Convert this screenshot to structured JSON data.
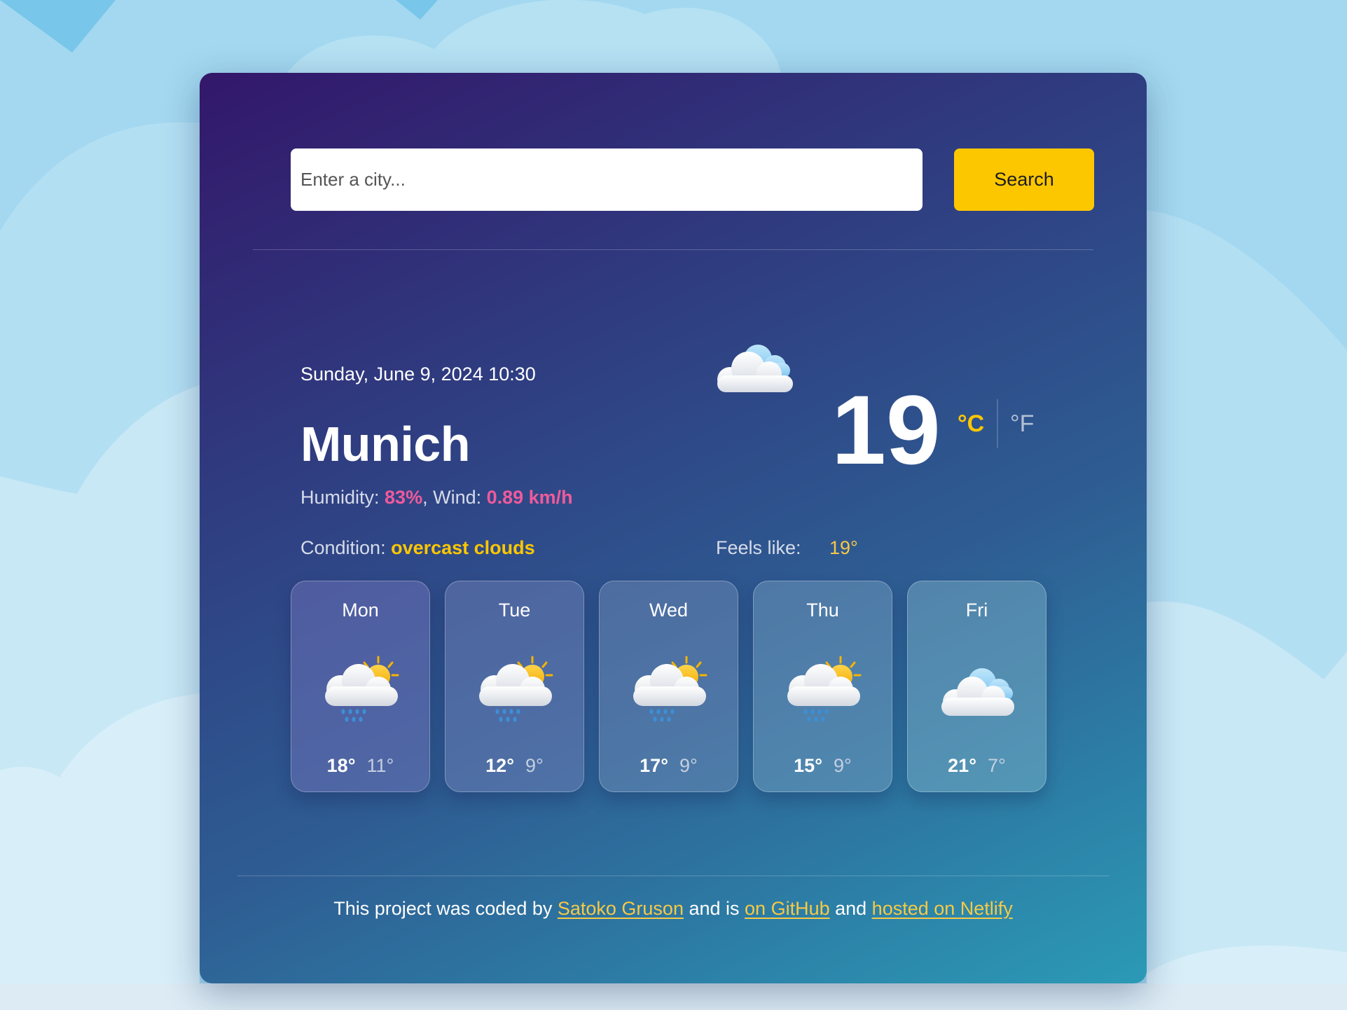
{
  "colors": {
    "accent_yellow": "#fdc700",
    "highlight_pink": "#ef5a9c",
    "card_gradient_start": "#33176a",
    "card_gradient_end": "#2b9ab6",
    "page_background": "#a3d8f0"
  },
  "search": {
    "placeholder": "Enter a city...",
    "value": "",
    "button_label": "Search"
  },
  "current": {
    "datetime": "Sunday, June 9, 2024 10:30",
    "city": "Munich",
    "humidity_label": "Humidity: ",
    "humidity_value": "83%",
    "wind_label": ", Wind: ",
    "wind_value": "0.89 km/h",
    "condition_label": "Condition: ",
    "condition_value": "overcast clouds",
    "icon": "cloud-icon",
    "temperature": "19",
    "unit_celsius": "°C",
    "unit_fahrenheit": "°F",
    "active_unit": "celsius",
    "feels_like_label": "Feels like:",
    "feels_like_value": "19°"
  },
  "forecast": [
    {
      "day": "Mon",
      "icon": "sun-cloud-rain-icon",
      "max": "18°",
      "min": "11°"
    },
    {
      "day": "Tue",
      "icon": "sun-cloud-rain-icon",
      "max": "12°",
      "min": "9°"
    },
    {
      "day": "Wed",
      "icon": "sun-cloud-rain-icon",
      "max": "17°",
      "min": "9°"
    },
    {
      "day": "Thu",
      "icon": "sun-cloud-rain-icon",
      "max": "15°",
      "min": "9°"
    },
    {
      "day": "Fri",
      "icon": "cloud-icon",
      "max": "21°",
      "min": "7°"
    }
  ],
  "footer": {
    "prefix": "This project was coded by ",
    "author_link": "Satoko Gruson",
    "middle": " and is ",
    "github_link": "on GitHub",
    "and": " and ",
    "netlify_link": "hosted on Netlify"
  }
}
